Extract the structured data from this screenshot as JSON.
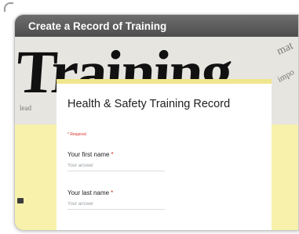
{
  "header": {
    "title": "Create a Record of Training"
  },
  "banner": {
    "headline": "Training",
    "fragments": [
      "mat",
      "impo",
      "lead"
    ]
  },
  "form": {
    "title": "Health & Safety Training Record",
    "required_note": "* Required",
    "questions": [
      {
        "label": "Your first name",
        "required_mark": "*",
        "placeholder": "Your answer"
      },
      {
        "label": "Your last name",
        "required_mark": "*",
        "placeholder": "Your answer"
      }
    ]
  },
  "colors": {
    "accent": "#f0e68c",
    "background": "#f7f1ac",
    "required": "#d93025"
  },
  "icons": {
    "side": "comment-icon"
  }
}
